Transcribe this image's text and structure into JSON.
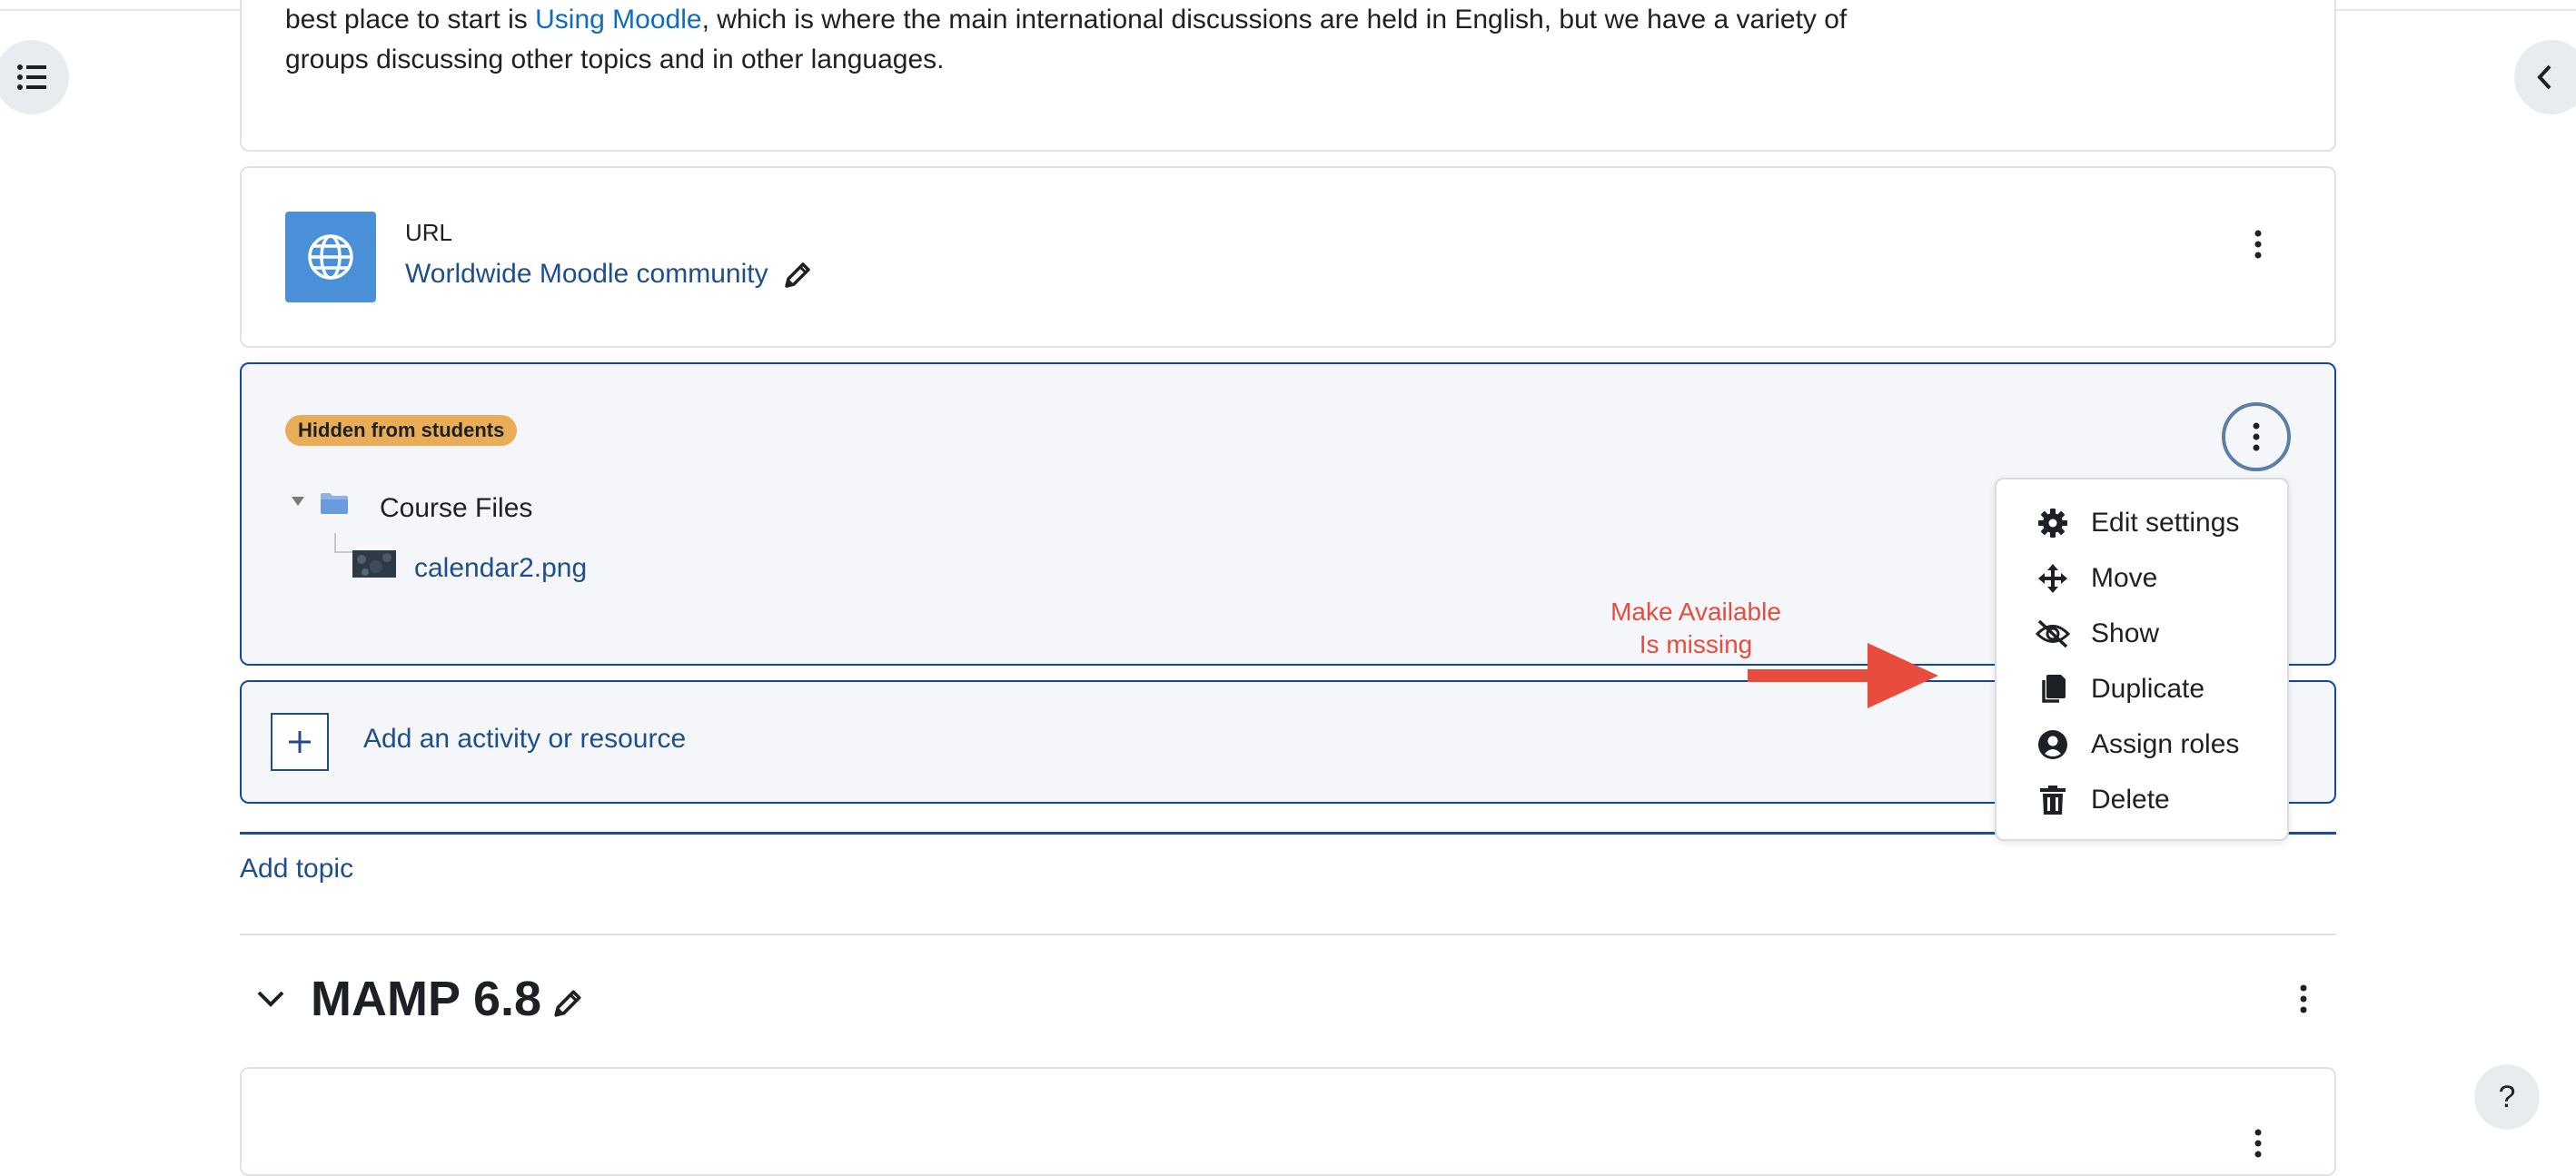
{
  "intro": {
    "line1_before": "best place to start is ",
    "line1_link": "Using Moodle",
    "line1_after": ", which is where the main international discussions are held in English, but we have a variety of",
    "line2": "groups discussing other topics and in other languages."
  },
  "url_activity": {
    "type_label": "URL",
    "name": "Worldwide Moodle community"
  },
  "folder_activity": {
    "badge": "Hidden from students",
    "folder_name": "Course Files",
    "file_name": "calendar2.png"
  },
  "action_menu": {
    "items": [
      {
        "label": "Edit settings",
        "icon": "gear-icon"
      },
      {
        "label": "Move",
        "icon": "move-icon"
      },
      {
        "label": "Show",
        "icon": "eye-slash-icon"
      },
      {
        "label": "Duplicate",
        "icon": "copy-icon"
      },
      {
        "label": "Assign roles",
        "icon": "user-circle-icon"
      },
      {
        "label": "Delete",
        "icon": "trash-icon"
      }
    ]
  },
  "annotation": {
    "line1": "Make Available",
    "line2": "Is missing",
    "color": "#e74c3c"
  },
  "add_activity": {
    "label": "Add an activity or resource"
  },
  "add_topic": {
    "label": "Add topic"
  },
  "section": {
    "title": "MAMP 6.8"
  },
  "help": {
    "label": "?"
  },
  "colors": {
    "link": "#0f6cbf",
    "primary": "#0f47ad",
    "badge": "#e9ad58",
    "url_icon_bg": "#4a90d9"
  }
}
